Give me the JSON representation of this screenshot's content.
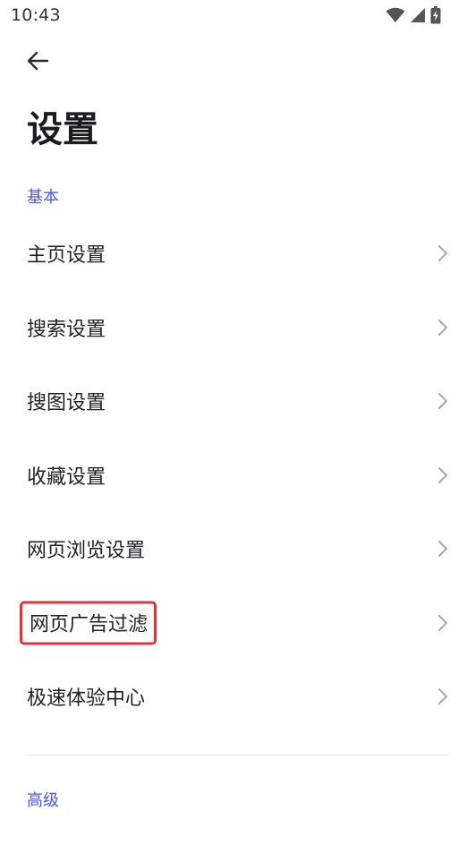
{
  "status_bar": {
    "time": "10:43",
    "icons": [
      "wifi-icon",
      "cellular-signal-icon",
      "battery-charging-icon"
    ]
  },
  "header": {
    "back_icon": "arrow-left-icon",
    "title": "设置"
  },
  "sections": {
    "basic": {
      "label": "基本",
      "items": [
        {
          "label": "主页设置"
        },
        {
          "label": "搜索设置"
        },
        {
          "label": "搜图设置"
        },
        {
          "label": "收藏设置"
        },
        {
          "label": "网页浏览设置"
        },
        {
          "label": "网页广告过滤",
          "highlighted": true
        },
        {
          "label": "极速体验中心"
        }
      ]
    },
    "advanced": {
      "label": "高级"
    }
  },
  "colors": {
    "accent": "#4a57e8",
    "highlight_border": "#d9383a",
    "chevron": "#a8a8ad",
    "divider": "#e6e6ea"
  }
}
